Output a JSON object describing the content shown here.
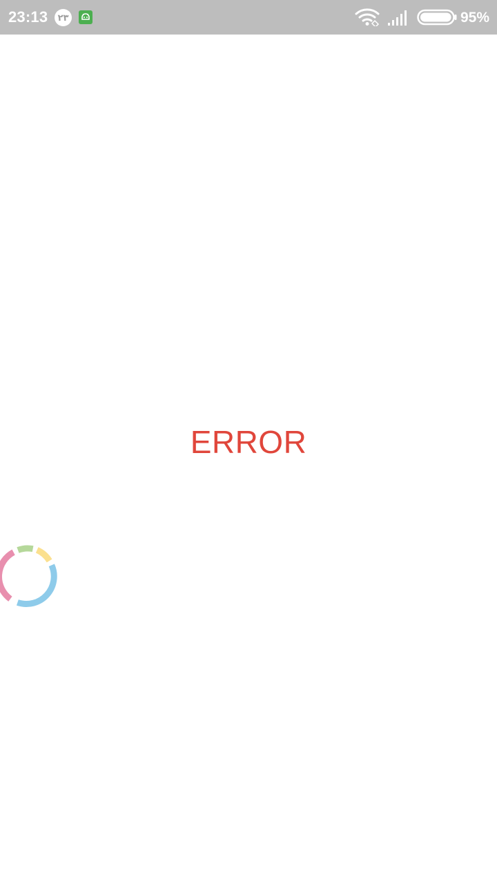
{
  "status_bar": {
    "time": "23:13",
    "date_badge": "٢٣",
    "battery_percent": "95%",
    "battery_level": 0.95,
    "icons": [
      "android-notification-icon",
      "wifi-icon",
      "signal-icon",
      "battery-icon"
    ]
  },
  "main": {
    "error_text": "ERROR",
    "error_color": "#e0463b"
  },
  "spinner": {
    "icon": "loading-spinner-icon",
    "colors": [
      "#8ecbea",
      "#e88fae",
      "#b5d89a",
      "#fbe08f"
    ]
  }
}
